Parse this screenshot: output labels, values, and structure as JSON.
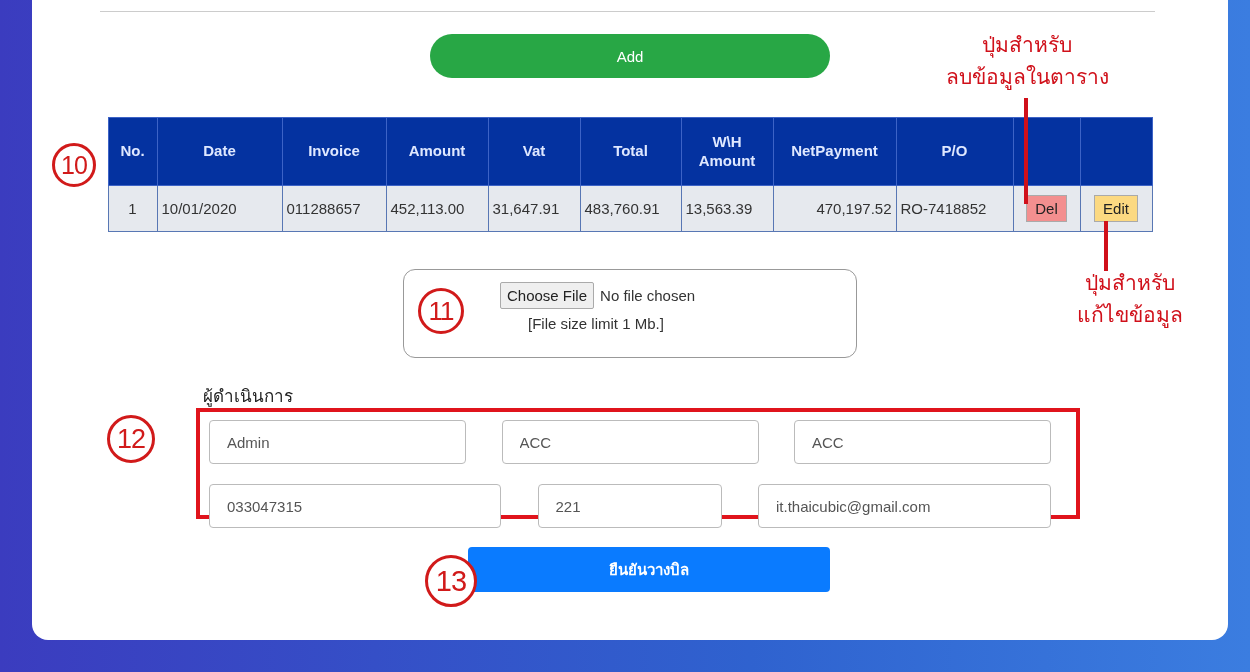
{
  "add_button": "Add",
  "table": {
    "columns": [
      "No.",
      "Date",
      "Invoice",
      "Amount",
      "Vat",
      "Total",
      "W\\H Amount",
      "NetPayment",
      "P/O"
    ],
    "rows": [
      {
        "cells": [
          "1",
          "10/01/2020",
          "011288657",
          "452,113.00",
          "31,647.91",
          "483,760.91",
          "13,563.39",
          "470,197.52",
          "RO-7418852"
        ],
        "del_button": "Del",
        "edit_button": "Edit"
      }
    ]
  },
  "file_upload": {
    "button": "Choose File",
    "status": "No file chosen",
    "note": "[File size limit 1 Mb.]"
  },
  "operator": {
    "label": "ผู้ดำเนินการ",
    "fields": [
      {
        "value": "Admin"
      },
      {
        "value": "ACC"
      },
      {
        "value": "ACC"
      },
      {
        "value": "033047315"
      },
      {
        "value": "221"
      },
      {
        "value": "it.thaicubic@gmail.com"
      }
    ]
  },
  "confirm_button": "ยืนยันวางบิล",
  "step_badges": [
    "10",
    "11",
    "12",
    "13"
  ],
  "callouts": [
    {
      "text": "ปุ่มสำหรับ\nลบข้อมูลในตาราง"
    },
    {
      "text": "ปุ่มสำหรับ\nแก้ไขข้อมูล"
    }
  ]
}
